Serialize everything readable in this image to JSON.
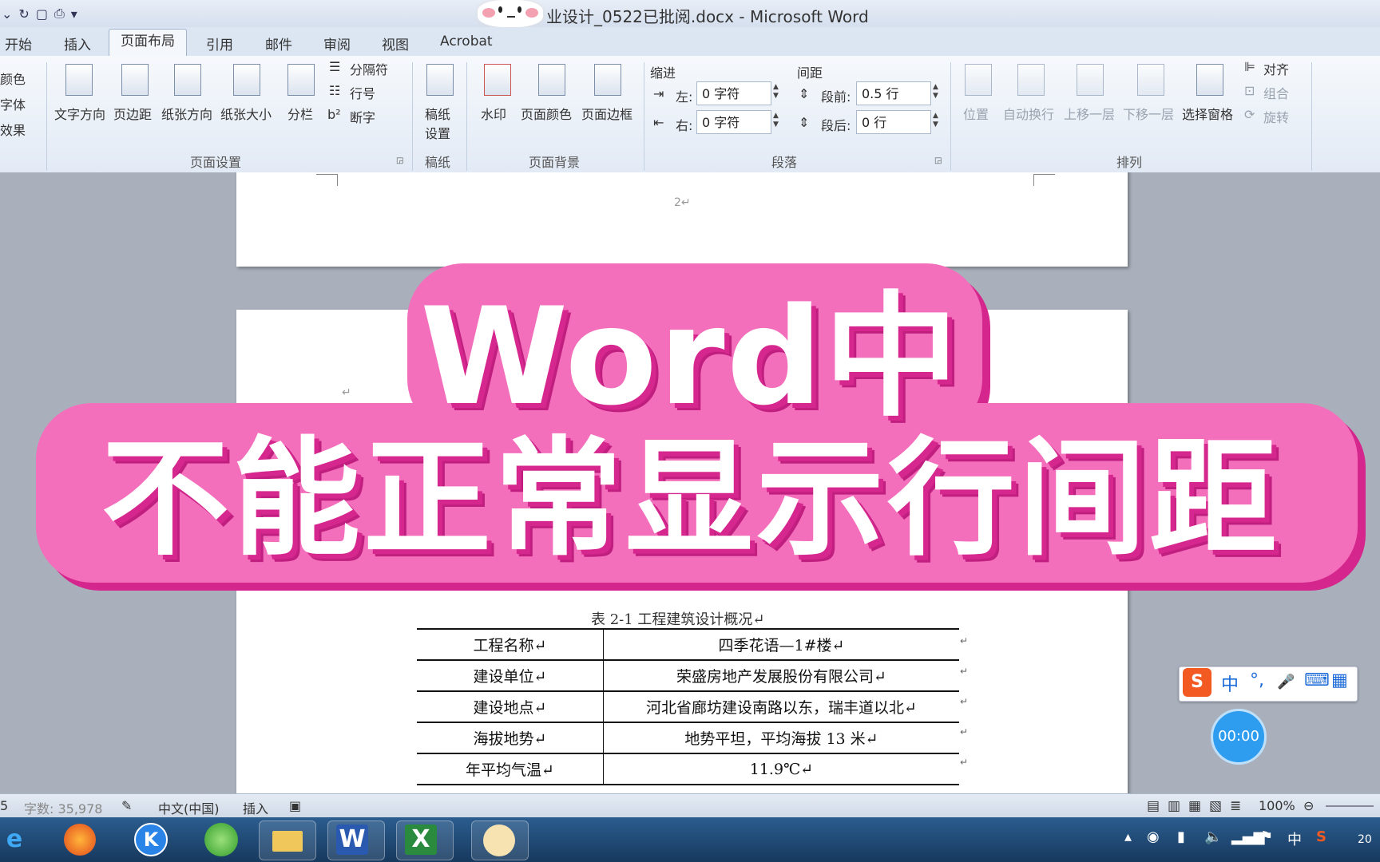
{
  "window": {
    "title": "业设计_0522已批阅.docx - Microsoft Word"
  },
  "tabs": [
    {
      "label": "开始"
    },
    {
      "label": "插入"
    },
    {
      "label": "页面布局",
      "active": true
    },
    {
      "label": "引用"
    },
    {
      "label": "邮件"
    },
    {
      "label": "审阅"
    },
    {
      "label": "视图"
    },
    {
      "label": "Acrobat"
    }
  ],
  "ribbon": {
    "theme": {
      "colors": "颜色",
      "fonts": "字体",
      "effects": "效果"
    },
    "page_setup": {
      "group_label": "页面设置",
      "text_direction": "文字方向",
      "margins": "页边距",
      "orientation": "纸张方向",
      "size": "纸张大小",
      "columns": "分栏",
      "breaks": "分隔符",
      "line_numbers": "行号",
      "hyphenation": "断字"
    },
    "manuscript": {
      "group_label": "稿纸",
      "button_line1": "稿纸",
      "button_line2": "设置"
    },
    "page_background": {
      "group_label": "页面背景",
      "watermark": "水印",
      "page_color": "页面颜色",
      "page_borders": "页面边框"
    },
    "paragraph": {
      "group_label": "段落",
      "indent_label": "缩进",
      "left_label": "左:",
      "left_value": "0 字符",
      "right_label": "右:",
      "right_value": "0 字符",
      "spacing_label": "间距",
      "before_label": "段前:",
      "before_value": "0.5 行",
      "after_label": "段后:",
      "after_value": "0 行"
    },
    "arrange": {
      "group_label": "排列",
      "position": "位置",
      "wrap_text": "自动换行",
      "bring_forward": "上移一层",
      "send_backward": "下移一层",
      "selection_pane": "选择窗格",
      "align": "对齐",
      "group": "组合",
      "rotate": "旋转"
    }
  },
  "document": {
    "page_number": "2↵",
    "para_mark": "↵",
    "table_caption": "表 2-1   工程建筑设计概况↵",
    "table": [
      [
        "工程名称↵",
        "四季花语—1#楼↵"
      ],
      [
        "建设单位↵",
        "荣盛房地产发展股份有限公司↵"
      ],
      [
        "建设地点↵",
        "河北省廊坊建设南路以东，瑞丰道以北↵"
      ],
      [
        "海拔地势↵",
        "地势平坦，平均海拔 13 米↵"
      ],
      [
        "年平均气温↵",
        "11.9℃↵"
      ]
    ],
    "row_mark": "↵"
  },
  "overlay": {
    "line1": "Word中",
    "line2": "不能正常显示行间距"
  },
  "ime": {
    "logo": "S",
    "mode": "中",
    "punct": "°,",
    "mic": "🎤",
    "keyboard": "⌨",
    "apps": "▦"
  },
  "timer": "00:00",
  "statusbar": {
    "page": "5",
    "word_count": "字数: 35,978",
    "language": "中文(中国)",
    "insert_mode": "插入",
    "zoom": "100%"
  },
  "taskbar": {
    "apps": [
      "ie-icon",
      "firefox-icon",
      "kugou-icon",
      "browser-icon",
      "explorer-icon",
      "word-icon",
      "excel-icon",
      "mascot-icon"
    ],
    "tray_ime": "中",
    "clock": "20"
  },
  "colors": {
    "overlay_pink": "#f46fbb",
    "overlay_shadow": "#d6278f",
    "taskbar": "#1e4a75"
  }
}
